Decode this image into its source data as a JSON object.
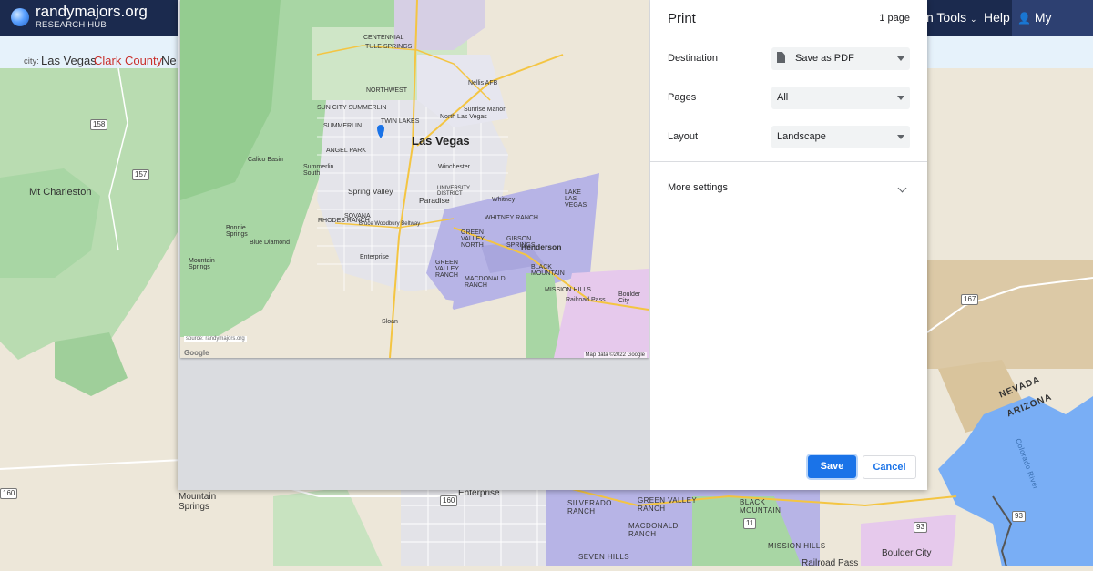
{
  "header": {
    "logo_name": "randymajors.org",
    "logo_sub": "RESEARCH HUB",
    "nav_tools": "n Tools",
    "nav_help": "Help",
    "nav_account": "My Account",
    "icons": [
      "globe-logo-icon",
      "user-icon"
    ]
  },
  "breadcrumb": {
    "label": "city:",
    "city": "Las Vegas",
    "county": "Clark County",
    "state_partial": "Ne"
  },
  "map_labels": {
    "mt_charleston": "Mt Charleston",
    "mountain_springs": "Mountain Springs",
    "enterprise": "Enterprise",
    "silverado_ranch": "SILVERADO RANCH",
    "green_valley_ranch": "GREEN VALLEY RANCH",
    "macdonald_ranch": "MACDONALD RANCH",
    "seven_hills": "SEVEN HILLS",
    "black_mountain": "BLACK MOUNTAIN",
    "mission_hills": "MISSION HILLS",
    "boulder_city": "Boulder City",
    "railroad_pass": "Railroad Pass",
    "nevada": "NEVADA",
    "arizona": "ARIZONA",
    "colorado_river": "Colorado River",
    "shields": [
      "158",
      "157",
      "160",
      "160",
      "167",
      "93",
      "93",
      "11"
    ]
  },
  "preview": {
    "city_title": "Las Vegas",
    "labels": {
      "centennial": "CENTENNIAL",
      "tule_springs": "TULE SPRINGS",
      "northwest": "NORTHWEST",
      "nellis_afb": "Nellis AFB",
      "sunrise_manor": "Sunrise Manor",
      "north_las_vegas": "North Las Vegas",
      "sun_city_summerlin": "SUN CITY SUMMERLIN",
      "twin_lakes": "TWIN LAKES",
      "summerlin": "SUMMERLIN",
      "angel_park": "ANGEL PARK",
      "calico_basin": "Calico Basin",
      "summerlin_south": "Summerlin South",
      "winchester": "Winchester",
      "spring_valley": "Spring Valley",
      "paradise": "Paradise",
      "whitney": "Whitney",
      "rhodes_ranch": "RHODES RANCH",
      "sovana": "SOVANA",
      "whitney_ranch": "WHITNEY RANCH",
      "lake_las_vegas": "LAKE LAS VEGAS",
      "green_valley_north": "GREEN VALLEY NORTH",
      "gibson_springs": "GIBSON SPRINGS",
      "henderson": "Henderson",
      "bonnie_springs": "Bonnie Springs",
      "blue_diamond": "Blue Diamond",
      "enterprise": "Enterprise",
      "green_valley_ranch": "GREEN VALLEY RANCH",
      "mountain_springs": "Mountain Springs",
      "macdonald_ranch": "MACDONALD RANCH",
      "black_mountain": "BLACK MOUNTAIN",
      "mission_hills": "MISSION HILLS",
      "boulder_city": "Boulder City",
      "railroad_pass": "Railroad Pass",
      "sloan": "Sloan",
      "university_district": "UNIVERSITY DISTRICT",
      "bruce_woodbury": "Bruce Woodbury Beltway"
    },
    "google": "Google",
    "source": "source: randymajors.org",
    "attribution": "Map data ©2022 Google"
  },
  "print": {
    "title": "Print",
    "page_count": "1 page",
    "destination_label": "Destination",
    "destination_value": "Save as PDF",
    "pages_label": "Pages",
    "pages_value": "All",
    "layout_label": "Layout",
    "layout_value": "Landscape",
    "more_settings": "More settings",
    "save": "Save",
    "cancel": "Cancel"
  },
  "colors": {
    "header_bg": "#1b2a4e",
    "breadcrumb_bg": "#e6f2fb",
    "accent_blue": "#1a73e8",
    "county_red": "#c9302c",
    "forest_green": "#a8d6a4",
    "city_purple": "#b7b4e6",
    "water_blue": "#79aef5"
  }
}
